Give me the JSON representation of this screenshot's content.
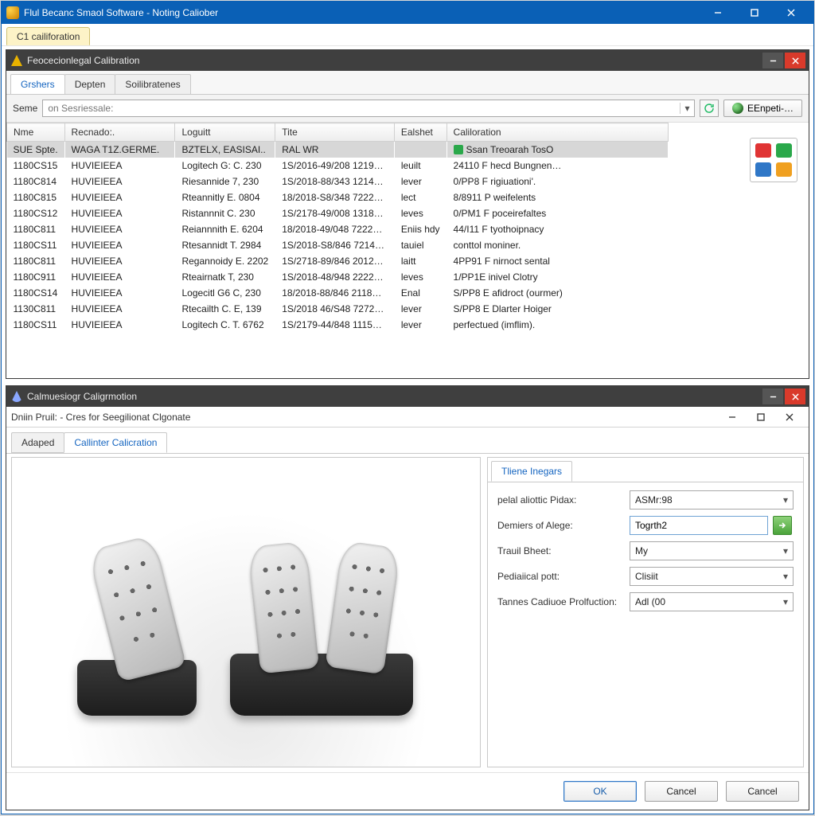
{
  "app": {
    "title": "Flul Becanc Smaol Software - Noting Caliober"
  },
  "menubar": {
    "tab0": "C1 cailiforation"
  },
  "panelA": {
    "title": "Feocecionlegal Calibration",
    "tabs": [
      "Grshers",
      "Depten",
      "Soilibratenes"
    ],
    "searchLabel": "Seme",
    "searchPlaceholder": "on Sesriessale:",
    "exportLabel": "EEnpeti-…",
    "columns": [
      "Nme",
      "Recnado:.",
      "Loguitt",
      "Tite",
      "Ealshet",
      "Caliloration"
    ],
    "rows": [
      {
        "sel": true,
        "nme": "SUE Spte.",
        "rec": "WAGA T1Z.GERME.",
        "log": "BZTELX,  EASISAI..",
        "tite": "RAL WR",
        "eal": "",
        "cal": "Ssan Treoarah TosO",
        "icon": true
      },
      {
        "nme": "1180CS15",
        "rec": "HUVIEIEEA",
        "log": "Logitech G: C.  230",
        "tite": "1S/2016-49/208 1219…",
        "eal": "leuilt",
        "cal": "24110 F hecd Bungnen…"
      },
      {
        "nme": "1180C814",
        "rec": "HUVIEIEEA",
        "log": "Riesannide 7,  230",
        "tite": "1S/2018-88/343 1214…",
        "eal": "lever",
        "cal": "0/PP8 F rigiuationi'."
      },
      {
        "nme": "1180C815",
        "rec": "HUVIEIEEA",
        "log": "Rteannitly E.  0804",
        "tite": "18/2018-S8/348 7222…",
        "eal": "lect",
        "cal": "8/8911 P weifelents"
      },
      {
        "nme": "1180CS12",
        "rec": "HUVIEIEEA",
        "log": "Ristannnit C.  230",
        "tite": "1S/2178-49/008 1318…",
        "eal": "leves",
        "cal": "0/PM1 F poceirefaltes"
      },
      {
        "nme": "1180C811",
        "rec": "HUVIEIEEA",
        "log": "Reiannnith E.  6204",
        "tite": "18/2018-49/048 7222…",
        "eal": "Eniis hdy",
        "cal": "44/I11 F tyothoipnacy"
      },
      {
        "nme": "1180CS11",
        "rec": "HUVIEIEEA",
        "log": "Rtesannidt T.  2984",
        "tite": "1S/2018-S8/846 7214…",
        "eal": "tauiel",
        "cal": "conttol moniner."
      },
      {
        "nme": "1180C811",
        "rec": "HUVIEIEEA",
        "log": "Regannoidy E.  2202",
        "tite": "1S/2718-89/846 2012…",
        "eal": "laitt",
        "cal": "4PP91 F nirnoct sental"
      },
      {
        "nme": "1180C911",
        "rec": "HUVIEIEEA",
        "log": "Rteairnatk T,  230",
        "tite": "1S/2018-48/948 2222…",
        "eal": "leves",
        "cal": "1/PP1E inivel Clotry"
      },
      {
        "nme": "1180CS14",
        "rec": "HUVIEIEEA",
        "log": "Logecitl G6 C,  230",
        "tite": "18/2018-88/846 2118…",
        "eal": "Enal",
        "cal": "S/PP8 E afidroct (ourmer)"
      },
      {
        "nme": "1130C811",
        "rec": "HUVIEIEEA",
        "log": "Rtecailth C.  E,  139",
        "tite": "1S/2018 46/S48 7272…",
        "eal": "lever",
        "cal": "S/PP8 E Dlarter Hoiger"
      },
      {
        "nme": "1180CS11",
        "rec": "HUVIEIEEA",
        "log": "Logitech C. T.  6762",
        "tite": "1S/2179-44/848 1115…",
        "eal": "lever",
        "cal": "perfectued (imflim)."
      }
    ]
  },
  "panelB": {
    "title": "Calmuesiogr Caligrmotion",
    "subTitle": "Dniin Pruil: - Cres for Seegilionat Clgonate",
    "leftTabs": [
      "Adaped",
      "Callinter Calicration"
    ],
    "rightTab": "Tliene Inegars",
    "fields": {
      "f1": {
        "label": "pelal aliottic Pidax:",
        "value": "ASMr:98"
      },
      "f2": {
        "label": "Demiers of Alege:",
        "value": "Togrth2"
      },
      "f3": {
        "label": "Trauil Bheet:",
        "value": "My"
      },
      "f4": {
        "label": "Pediaiical pott:",
        "value": "Clisiit"
      },
      "f5": {
        "label": "Tannes Cadiuoe Prolfuction:",
        "value": "Adl (00"
      }
    },
    "buttons": {
      "ok": "OK",
      "cancel1": "Cancel",
      "cancel2": "Cancel"
    }
  }
}
